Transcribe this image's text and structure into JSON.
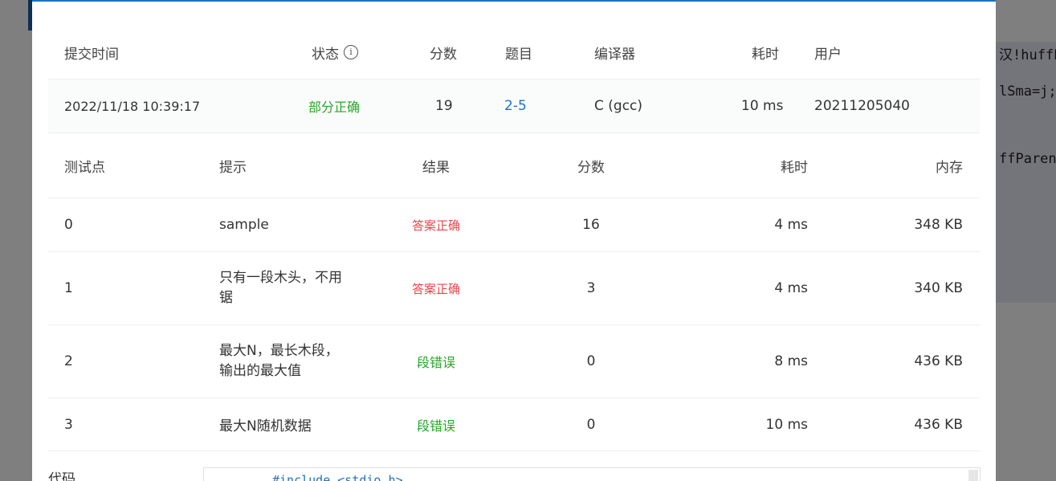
{
  "background": {
    "code_lines": [
      "汉!huffPa",
      "lSma=j;",
      "ffParent"
    ]
  },
  "summary": {
    "headers": {
      "submit_time": "提交时间",
      "status": "状态",
      "score": "分数",
      "problem": "题目",
      "compiler": "编译器",
      "time": "耗时",
      "user": "用户"
    },
    "row": {
      "submit_time": "2022/11/18 10:39:17",
      "status": "部分正确",
      "score": "19",
      "problem": "2-5",
      "compiler": "C (gcc)",
      "time": "10 ms",
      "user": "20211205040"
    }
  },
  "testcases": {
    "headers": {
      "case": "测试点",
      "hint": "提示",
      "result": "结果",
      "score": "分数",
      "time": "耗时",
      "memory": "内存"
    },
    "rows": [
      {
        "case": "0",
        "hint": "sample",
        "result": "答案正确",
        "score": "16",
        "time": "4 ms",
        "memory": "348 KB"
      },
      {
        "case": "1",
        "hint": "只有一段木头，不用锯",
        "result": "答案正确",
        "score": "3",
        "time": "4 ms",
        "memory": "340 KB"
      },
      {
        "case": "2",
        "hint": "最大N，最长木段，输出的最大值",
        "result": "段错误",
        "score": "0",
        "time": "8 ms",
        "memory": "436 KB"
      },
      {
        "case": "3",
        "hint": "最大N随机数据",
        "result": "段错误",
        "score": "0",
        "time": "10 ms",
        "memory": "436 KB"
      }
    ]
  },
  "code": {
    "label": "代码",
    "first_line": "#include <stdio.h>"
  },
  "colors": {
    "accent": "#1e73be",
    "success": "#2aa52a",
    "error": "#e5484d"
  }
}
